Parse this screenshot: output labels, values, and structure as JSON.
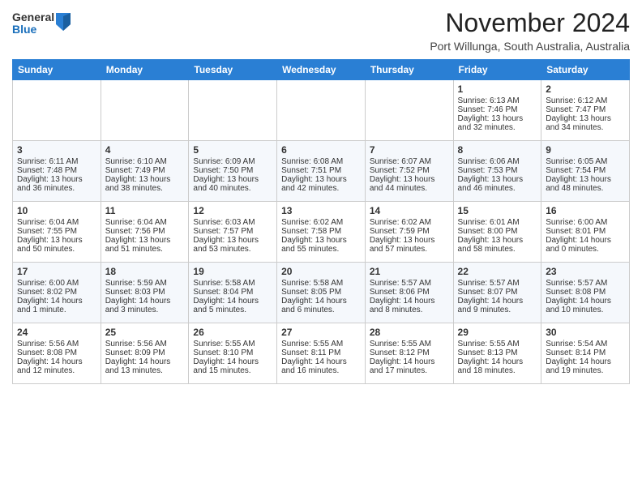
{
  "header": {
    "logo_general": "General",
    "logo_blue": "Blue",
    "month_title": "November 2024",
    "location": "Port Willunga, South Australia, Australia"
  },
  "weekdays": [
    "Sunday",
    "Monday",
    "Tuesday",
    "Wednesday",
    "Thursday",
    "Friday",
    "Saturday"
  ],
  "weeks": [
    [
      {
        "day": "",
        "info": ""
      },
      {
        "day": "",
        "info": ""
      },
      {
        "day": "",
        "info": ""
      },
      {
        "day": "",
        "info": ""
      },
      {
        "day": "",
        "info": ""
      },
      {
        "day": "1",
        "info": "Sunrise: 6:13 AM\nSunset: 7:46 PM\nDaylight: 13 hours\nand 32 minutes."
      },
      {
        "day": "2",
        "info": "Sunrise: 6:12 AM\nSunset: 7:47 PM\nDaylight: 13 hours\nand 34 minutes."
      }
    ],
    [
      {
        "day": "3",
        "info": "Sunrise: 6:11 AM\nSunset: 7:48 PM\nDaylight: 13 hours\nand 36 minutes."
      },
      {
        "day": "4",
        "info": "Sunrise: 6:10 AM\nSunset: 7:49 PM\nDaylight: 13 hours\nand 38 minutes."
      },
      {
        "day": "5",
        "info": "Sunrise: 6:09 AM\nSunset: 7:50 PM\nDaylight: 13 hours\nand 40 minutes."
      },
      {
        "day": "6",
        "info": "Sunrise: 6:08 AM\nSunset: 7:51 PM\nDaylight: 13 hours\nand 42 minutes."
      },
      {
        "day": "7",
        "info": "Sunrise: 6:07 AM\nSunset: 7:52 PM\nDaylight: 13 hours\nand 44 minutes."
      },
      {
        "day": "8",
        "info": "Sunrise: 6:06 AM\nSunset: 7:53 PM\nDaylight: 13 hours\nand 46 minutes."
      },
      {
        "day": "9",
        "info": "Sunrise: 6:05 AM\nSunset: 7:54 PM\nDaylight: 13 hours\nand 48 minutes."
      }
    ],
    [
      {
        "day": "10",
        "info": "Sunrise: 6:04 AM\nSunset: 7:55 PM\nDaylight: 13 hours\nand 50 minutes."
      },
      {
        "day": "11",
        "info": "Sunrise: 6:04 AM\nSunset: 7:56 PM\nDaylight: 13 hours\nand 51 minutes."
      },
      {
        "day": "12",
        "info": "Sunrise: 6:03 AM\nSunset: 7:57 PM\nDaylight: 13 hours\nand 53 minutes."
      },
      {
        "day": "13",
        "info": "Sunrise: 6:02 AM\nSunset: 7:58 PM\nDaylight: 13 hours\nand 55 minutes."
      },
      {
        "day": "14",
        "info": "Sunrise: 6:02 AM\nSunset: 7:59 PM\nDaylight: 13 hours\nand 57 minutes."
      },
      {
        "day": "15",
        "info": "Sunrise: 6:01 AM\nSunset: 8:00 PM\nDaylight: 13 hours\nand 58 minutes."
      },
      {
        "day": "16",
        "info": "Sunrise: 6:00 AM\nSunset: 8:01 PM\nDaylight: 14 hours\nand 0 minutes."
      }
    ],
    [
      {
        "day": "17",
        "info": "Sunrise: 6:00 AM\nSunset: 8:02 PM\nDaylight: 14 hours\nand 1 minute."
      },
      {
        "day": "18",
        "info": "Sunrise: 5:59 AM\nSunset: 8:03 PM\nDaylight: 14 hours\nand 3 minutes."
      },
      {
        "day": "19",
        "info": "Sunrise: 5:58 AM\nSunset: 8:04 PM\nDaylight: 14 hours\nand 5 minutes."
      },
      {
        "day": "20",
        "info": "Sunrise: 5:58 AM\nSunset: 8:05 PM\nDaylight: 14 hours\nand 6 minutes."
      },
      {
        "day": "21",
        "info": "Sunrise: 5:57 AM\nSunset: 8:06 PM\nDaylight: 14 hours\nand 8 minutes."
      },
      {
        "day": "22",
        "info": "Sunrise: 5:57 AM\nSunset: 8:07 PM\nDaylight: 14 hours\nand 9 minutes."
      },
      {
        "day": "23",
        "info": "Sunrise: 5:57 AM\nSunset: 8:08 PM\nDaylight: 14 hours\nand 10 minutes."
      }
    ],
    [
      {
        "day": "24",
        "info": "Sunrise: 5:56 AM\nSunset: 8:08 PM\nDaylight: 14 hours\nand 12 minutes."
      },
      {
        "day": "25",
        "info": "Sunrise: 5:56 AM\nSunset: 8:09 PM\nDaylight: 14 hours\nand 13 minutes."
      },
      {
        "day": "26",
        "info": "Sunrise: 5:55 AM\nSunset: 8:10 PM\nDaylight: 14 hours\nand 15 minutes."
      },
      {
        "day": "27",
        "info": "Sunrise: 5:55 AM\nSunset: 8:11 PM\nDaylight: 14 hours\nand 16 minutes."
      },
      {
        "day": "28",
        "info": "Sunrise: 5:55 AM\nSunset: 8:12 PM\nDaylight: 14 hours\nand 17 minutes."
      },
      {
        "day": "29",
        "info": "Sunrise: 5:55 AM\nSunset: 8:13 PM\nDaylight: 14 hours\nand 18 minutes."
      },
      {
        "day": "30",
        "info": "Sunrise: 5:54 AM\nSunset: 8:14 PM\nDaylight: 14 hours\nand 19 minutes."
      }
    ]
  ]
}
